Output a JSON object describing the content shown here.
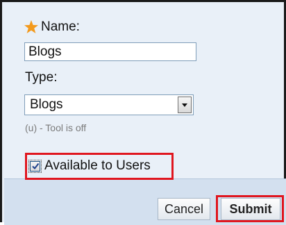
{
  "form": {
    "name_label": "Name:",
    "name_value": "Blogs",
    "type_label": "Type:",
    "type_selected": "Blogs",
    "tool_status": "(u) - Tool is off",
    "available_label": "Available to Users",
    "available_checked": true
  },
  "actions": {
    "cancel_label": "Cancel",
    "submit_label": "Submit"
  },
  "colors": {
    "required_star": "#f39a1d",
    "highlight": "#e0161f",
    "panel_bg": "#e9f0f8",
    "footer_bg": "#d3e0ef"
  },
  "icons": {
    "required": "star-icon",
    "checkmark": "checkmark-icon",
    "dropdown": "chevron-down-icon"
  }
}
